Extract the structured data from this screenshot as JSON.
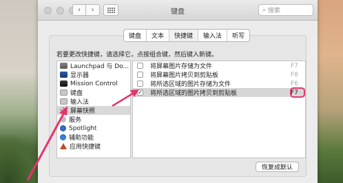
{
  "window": {
    "title": "键盘",
    "search_placeholder": "搜索"
  },
  "tabs": [
    {
      "label": "键盘",
      "active": false
    },
    {
      "label": "文本",
      "active": false
    },
    {
      "label": "快捷键",
      "active": true
    },
    {
      "label": "输入法",
      "active": false
    },
    {
      "label": "听写",
      "active": false
    }
  ],
  "instructions": "若要更改快捷键，请选择它，点按组合键，然后键入新键。",
  "categories": [
    {
      "label": "Launchpad 与 Do...",
      "icon": "launchpad-icon"
    },
    {
      "label": "显示器",
      "icon": "display-icon"
    },
    {
      "label": "Mission Control",
      "icon": "mission-control-icon"
    },
    {
      "label": "键盘",
      "icon": "keyboard-icon"
    },
    {
      "label": "输入法",
      "icon": "input-method-icon"
    },
    {
      "label": "屏幕快照",
      "icon": "screenshot-icon",
      "selected": true
    },
    {
      "label": "服务",
      "icon": "services-icon"
    },
    {
      "label": "Spotlight",
      "icon": "spotlight-icon"
    },
    {
      "label": "辅助功能",
      "icon": "accessibility-icon"
    },
    {
      "label": "应用快捷键",
      "icon": "app-shortcuts-icon"
    }
  ],
  "shortcuts": [
    {
      "label": "将屏幕图片存储为文件",
      "checked": false,
      "key": "F7"
    },
    {
      "label": "将屏幕图片拷贝到剪贴板",
      "checked": false,
      "key": "F8"
    },
    {
      "label": "将所选区域的图片存储为文件",
      "checked": false,
      "key": "F6"
    },
    {
      "label": "将所选区域的图片拷贝到剪贴板",
      "checked": true,
      "key": "F7"
    }
  ],
  "restore_button": "恢复成默认",
  "help_label": "?",
  "colors": {
    "annotation": "#e4346e"
  }
}
